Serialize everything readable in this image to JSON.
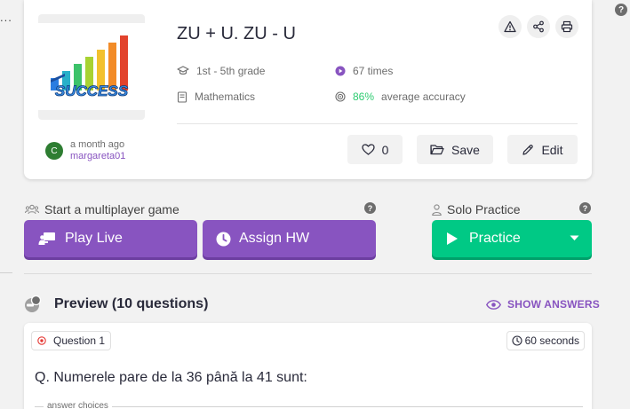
{
  "help_glyph": "?",
  "left_menu_label": "...",
  "quiz": {
    "title": "ZU + U. ZU - U",
    "thumbnail_text": "SUCCESS",
    "grade": "1st - 5th grade",
    "subject": "Mathematics",
    "plays": "67 times",
    "accuracy_value": "86%",
    "accuracy_label": "average accuracy",
    "author_initial": "C",
    "author_time": "a month ago",
    "author_name": "margareta01",
    "likes": "0",
    "save_label": "Save",
    "edit_label": "Edit"
  },
  "multiplayer": {
    "label": "Start a multiplayer game",
    "play_live": "Play Live",
    "assign_hw": "Assign HW"
  },
  "solo": {
    "label": "Solo Practice",
    "practice": "Practice"
  },
  "preview": {
    "title": "Preview (10 questions)",
    "show_answers": "SHOW ANSWERS"
  },
  "question": {
    "label": "Question 1",
    "time": "60 seconds",
    "text": "Q. Numerele pare de la 36 până la 41 sunt:",
    "answer_choices_label": "answer choices"
  },
  "colors": {
    "brand_purple": "#8854c0",
    "practice_green": "#00c985",
    "accuracy_green": "#2ecc71"
  }
}
